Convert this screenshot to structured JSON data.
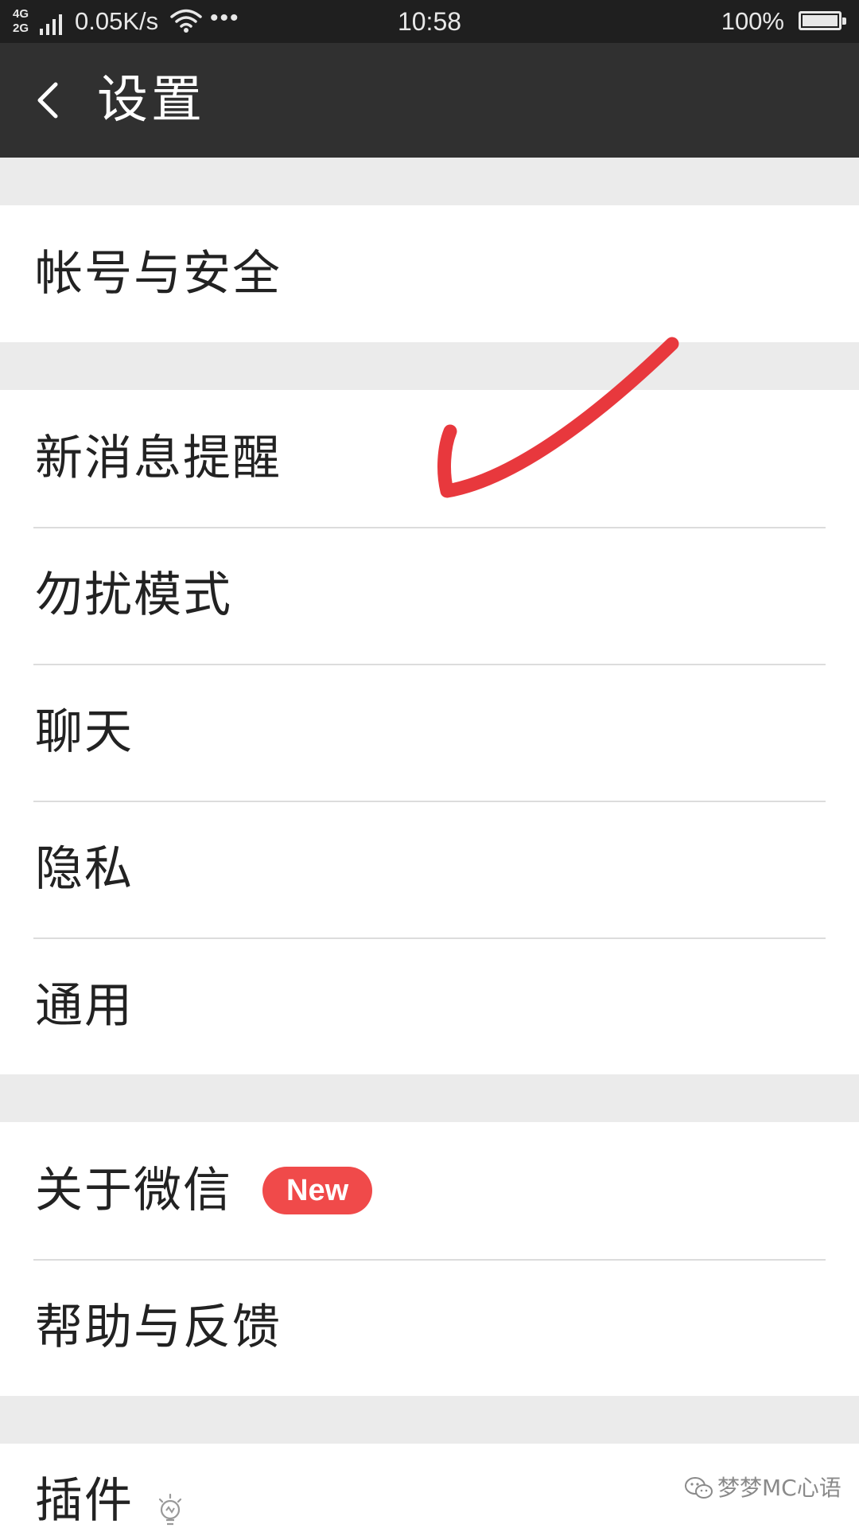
{
  "status_bar": {
    "network_top": "4G",
    "network_bottom": "2G",
    "speed": "0.05K/s",
    "more": "•••",
    "time": "10:58",
    "battery_percent": "100%",
    "battery_level": 1.0,
    "icons": [
      "signal-icon",
      "wifi-icon",
      "battery-icon"
    ]
  },
  "titlebar": {
    "back_icon": "back-arrow-icon",
    "title": "设置"
  },
  "groups": [
    {
      "items": [
        {
          "label": "帐号与安全"
        }
      ]
    },
    {
      "items": [
        {
          "label": "新消息提醒"
        },
        {
          "label": "勿扰模式"
        },
        {
          "label": "聊天"
        },
        {
          "label": "隐私"
        },
        {
          "label": "通用"
        }
      ]
    },
    {
      "items": [
        {
          "label": "关于微信",
          "badge": "New"
        },
        {
          "label": "帮助与反馈"
        }
      ]
    },
    {
      "items": [
        {
          "label": "插件",
          "icon": "bulb-icon"
        }
      ]
    }
  ],
  "annotation": {
    "type": "red-check-mark",
    "color": "#e8383d"
  },
  "watermark": {
    "icon": "wechat-icon",
    "text": "梦梦MC心语"
  },
  "colors": {
    "status_bar_bg": "#1f1f1f",
    "title_bar_bg": "#303030",
    "page_bg": "#ebebeb",
    "row_bg": "#ffffff",
    "badge_bg": "#f04a4a",
    "divider": "#dcdcdc"
  }
}
